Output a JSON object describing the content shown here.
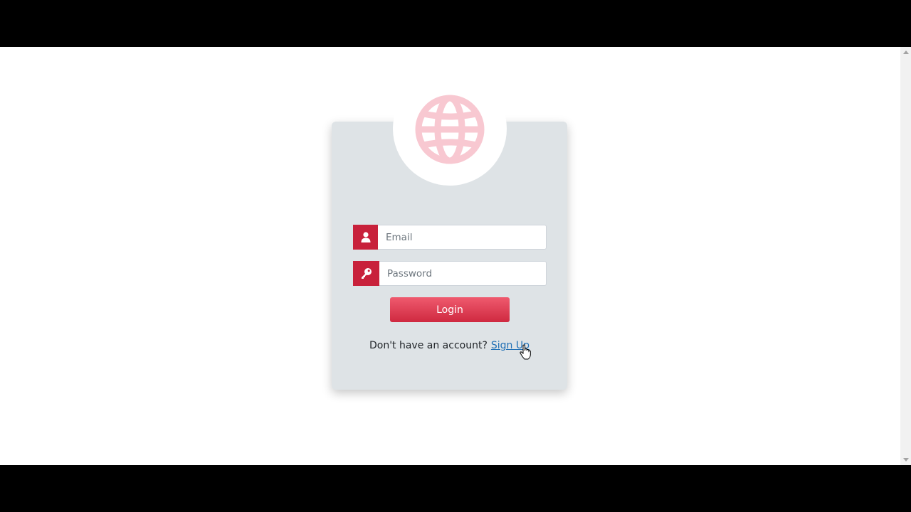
{
  "login_form": {
    "email_placeholder": "Email",
    "password_placeholder": "Password",
    "login_label": "Login",
    "signup_prompt": "Don't have an account?",
    "signup_link": "Sign Up"
  },
  "icons": {
    "logo": "globe-icon",
    "email_addon": "user-icon",
    "password_addon": "key-icon"
  },
  "colors": {
    "accent": "#c8213b",
    "button_gradient_top": "#ef5a6e",
    "button_gradient_bottom": "#cf2940",
    "card_background": "#dee3e6",
    "logo_tint": "#f8c8d1",
    "link": "#1f6fb5"
  }
}
